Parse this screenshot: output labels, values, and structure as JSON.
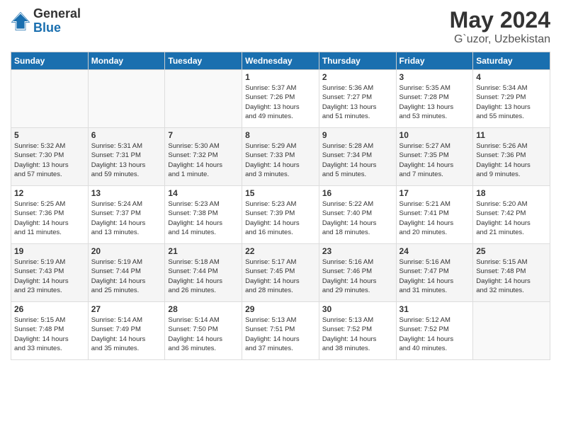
{
  "logo": {
    "general": "General",
    "blue": "Blue"
  },
  "title": {
    "month": "May 2024",
    "location": "G`uzor, Uzbekistan"
  },
  "weekdays": [
    "Sunday",
    "Monday",
    "Tuesday",
    "Wednesday",
    "Thursday",
    "Friday",
    "Saturday"
  ],
  "weeks": [
    [
      {
        "day": "",
        "info": ""
      },
      {
        "day": "",
        "info": ""
      },
      {
        "day": "",
        "info": ""
      },
      {
        "day": "1",
        "info": "Sunrise: 5:37 AM\nSunset: 7:26 PM\nDaylight: 13 hours\nand 49 minutes."
      },
      {
        "day": "2",
        "info": "Sunrise: 5:36 AM\nSunset: 7:27 PM\nDaylight: 13 hours\nand 51 minutes."
      },
      {
        "day": "3",
        "info": "Sunrise: 5:35 AM\nSunset: 7:28 PM\nDaylight: 13 hours\nand 53 minutes."
      },
      {
        "day": "4",
        "info": "Sunrise: 5:34 AM\nSunset: 7:29 PM\nDaylight: 13 hours\nand 55 minutes."
      }
    ],
    [
      {
        "day": "5",
        "info": "Sunrise: 5:32 AM\nSunset: 7:30 PM\nDaylight: 13 hours\nand 57 minutes."
      },
      {
        "day": "6",
        "info": "Sunrise: 5:31 AM\nSunset: 7:31 PM\nDaylight: 13 hours\nand 59 minutes."
      },
      {
        "day": "7",
        "info": "Sunrise: 5:30 AM\nSunset: 7:32 PM\nDaylight: 14 hours\nand 1 minute."
      },
      {
        "day": "8",
        "info": "Sunrise: 5:29 AM\nSunset: 7:33 PM\nDaylight: 14 hours\nand 3 minutes."
      },
      {
        "day": "9",
        "info": "Sunrise: 5:28 AM\nSunset: 7:34 PM\nDaylight: 14 hours\nand 5 minutes."
      },
      {
        "day": "10",
        "info": "Sunrise: 5:27 AM\nSunset: 7:35 PM\nDaylight: 14 hours\nand 7 minutes."
      },
      {
        "day": "11",
        "info": "Sunrise: 5:26 AM\nSunset: 7:36 PM\nDaylight: 14 hours\nand 9 minutes."
      }
    ],
    [
      {
        "day": "12",
        "info": "Sunrise: 5:25 AM\nSunset: 7:36 PM\nDaylight: 14 hours\nand 11 minutes."
      },
      {
        "day": "13",
        "info": "Sunrise: 5:24 AM\nSunset: 7:37 PM\nDaylight: 14 hours\nand 13 minutes."
      },
      {
        "day": "14",
        "info": "Sunrise: 5:23 AM\nSunset: 7:38 PM\nDaylight: 14 hours\nand 14 minutes."
      },
      {
        "day": "15",
        "info": "Sunrise: 5:23 AM\nSunset: 7:39 PM\nDaylight: 14 hours\nand 16 minutes."
      },
      {
        "day": "16",
        "info": "Sunrise: 5:22 AM\nSunset: 7:40 PM\nDaylight: 14 hours\nand 18 minutes."
      },
      {
        "day": "17",
        "info": "Sunrise: 5:21 AM\nSunset: 7:41 PM\nDaylight: 14 hours\nand 20 minutes."
      },
      {
        "day": "18",
        "info": "Sunrise: 5:20 AM\nSunset: 7:42 PM\nDaylight: 14 hours\nand 21 minutes."
      }
    ],
    [
      {
        "day": "19",
        "info": "Sunrise: 5:19 AM\nSunset: 7:43 PM\nDaylight: 14 hours\nand 23 minutes."
      },
      {
        "day": "20",
        "info": "Sunrise: 5:19 AM\nSunset: 7:44 PM\nDaylight: 14 hours\nand 25 minutes."
      },
      {
        "day": "21",
        "info": "Sunrise: 5:18 AM\nSunset: 7:44 PM\nDaylight: 14 hours\nand 26 minutes."
      },
      {
        "day": "22",
        "info": "Sunrise: 5:17 AM\nSunset: 7:45 PM\nDaylight: 14 hours\nand 28 minutes."
      },
      {
        "day": "23",
        "info": "Sunrise: 5:16 AM\nSunset: 7:46 PM\nDaylight: 14 hours\nand 29 minutes."
      },
      {
        "day": "24",
        "info": "Sunrise: 5:16 AM\nSunset: 7:47 PM\nDaylight: 14 hours\nand 31 minutes."
      },
      {
        "day": "25",
        "info": "Sunrise: 5:15 AM\nSunset: 7:48 PM\nDaylight: 14 hours\nand 32 minutes."
      }
    ],
    [
      {
        "day": "26",
        "info": "Sunrise: 5:15 AM\nSunset: 7:48 PM\nDaylight: 14 hours\nand 33 minutes."
      },
      {
        "day": "27",
        "info": "Sunrise: 5:14 AM\nSunset: 7:49 PM\nDaylight: 14 hours\nand 35 minutes."
      },
      {
        "day": "28",
        "info": "Sunrise: 5:14 AM\nSunset: 7:50 PM\nDaylight: 14 hours\nand 36 minutes."
      },
      {
        "day": "29",
        "info": "Sunrise: 5:13 AM\nSunset: 7:51 PM\nDaylight: 14 hours\nand 37 minutes."
      },
      {
        "day": "30",
        "info": "Sunrise: 5:13 AM\nSunset: 7:52 PM\nDaylight: 14 hours\nand 38 minutes."
      },
      {
        "day": "31",
        "info": "Sunrise: 5:12 AM\nSunset: 7:52 PM\nDaylight: 14 hours\nand 40 minutes."
      },
      {
        "day": "",
        "info": ""
      }
    ]
  ]
}
